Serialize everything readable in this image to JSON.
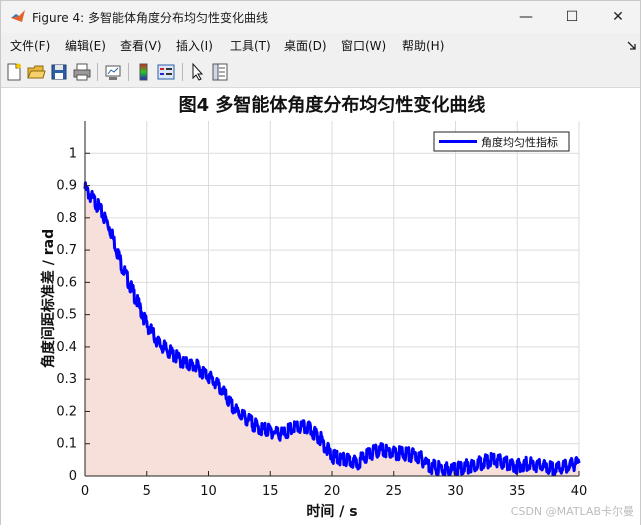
{
  "window": {
    "title": "Figure 4: 多智能体角度分布均匀性变化曲线",
    "controls": {
      "minimize": "—",
      "maximize": "☐",
      "close": "✕"
    }
  },
  "menu": {
    "items": [
      "文件(F)",
      "编辑(E)",
      "查看(V)",
      "插入(I)",
      "工具(T)",
      "桌面(D)",
      "窗口(W)",
      "帮助(H)"
    ],
    "overflow_icon": "dock-arrow-icon"
  },
  "toolbar": {
    "icons": [
      "new-figure-icon",
      "open-icon",
      "save-icon",
      "print-icon",
      "link-plot-icon",
      "colorbar-icon",
      "legend-icon",
      "select-arrow-icon",
      "property-inspector-icon"
    ]
  },
  "chart_data": {
    "type": "area",
    "title": "图4 多智能体角度分布均匀性变化曲线",
    "xlabel": "时间 / s",
    "ylabel": "角度间距标准差 / rad",
    "xlim": [
      0,
      40
    ],
    "ylim": [
      0,
      1.1
    ],
    "xticks": [
      "0",
      "5",
      "10",
      "15",
      "20",
      "25",
      "30",
      "35",
      "40"
    ],
    "yticks": [
      "0",
      "0.1",
      "0.2",
      "0.3",
      "0.4",
      "0.5",
      "0.6",
      "0.7",
      "0.8",
      "0.9",
      "1"
    ],
    "grid": true,
    "legend_position": "top-right",
    "series": [
      {
        "name": "角度均匀性指标",
        "color": "#0000ff",
        "fill_color": "#f8e0da",
        "x": [
          0,
          1,
          2,
          3,
          4,
          5,
          6,
          7,
          8,
          9,
          10,
          11,
          12,
          13,
          14,
          15,
          16,
          17,
          18,
          19,
          20,
          21,
          22,
          23,
          24,
          25,
          26,
          27,
          28,
          29,
          30,
          31,
          32,
          33,
          34,
          35,
          36,
          37,
          38,
          39,
          40
        ],
        "y": [
          0.89,
          0.84,
          0.77,
          0.65,
          0.56,
          0.47,
          0.41,
          0.38,
          0.35,
          0.34,
          0.31,
          0.27,
          0.21,
          0.18,
          0.15,
          0.14,
          0.13,
          0.15,
          0.15,
          0.12,
          0.06,
          0.05,
          0.04,
          0.07,
          0.08,
          0.07,
          0.07,
          0.06,
          0.03,
          0.02,
          0.02,
          0.03,
          0.04,
          0.05,
          0.04,
          0.03,
          0.04,
          0.03,
          0.02,
          0.03,
          0.04
        ]
      }
    ]
  },
  "watermark": "CSDN @MATLAB卡尔曼"
}
